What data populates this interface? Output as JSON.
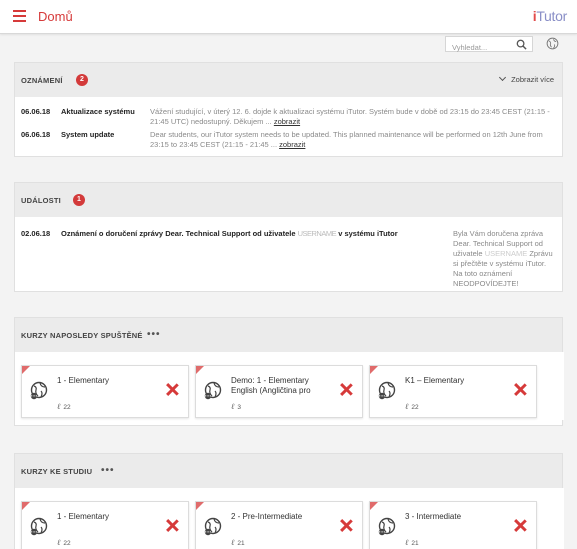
{
  "header": {
    "menu_icon": "hamburger-icon",
    "title": "Domů",
    "logo_part1": "i",
    "logo_part2": "Tutor"
  },
  "search": {
    "placeholder": "Vyhledat...",
    "search_icon": "search-icon",
    "language_icon": "globe-icon"
  },
  "announcements": {
    "title": "OZNÁMENÍ",
    "badge": "2",
    "show_more": "Zobrazit více",
    "items": [
      {
        "date": "06.06.18",
        "title": "Aktualizace systému",
        "text": "Vážení studující, v úterý 12. 6. dojde k aktualizaci systému iTutor. Systém bude v době od 23:15 do 23:45 CEST (21:15 - 21:45 UTC) nedostupný. Děkujem ...",
        "link": "zobrazit"
      },
      {
        "date": "06.06.18",
        "title": "System update",
        "text": "Dear students, our iTutor system needs to be updated. This planned maintenance will be performed on 12th June from 23:15 to 23:45 CEST (21:15 - 21:45 ...",
        "link": "zobrazit"
      }
    ]
  },
  "events": {
    "title": "UDÁLOSTI",
    "badge": "1",
    "items": [
      {
        "date": "02.06.18",
        "title_prefix": "Oznámení o doručení zprávy Dear. Technical Support od uživatele",
        "title_blurred": "USERNAME",
        "title_suffix": "v systému iTutor",
        "text_prefix": "Byla Vám doručena zpráva Dear. Technical Support od uživatele",
        "text_blurred": "USERNAME",
        "text_suffix": "Zprávu si přečtěte v systému iTutor. Na toto oznámení NEODPOVÍDEJTE!"
      }
    ]
  },
  "recent_courses": {
    "title": "KURZY NAPOSLEDY SPUŠTĚNÉ",
    "more": "•••",
    "cards": [
      {
        "title": "1 - Elementary",
        "count": "22"
      },
      {
        "title": "Demo: 1 - Elementary English (Angličtina pro",
        "count": "3"
      },
      {
        "title": "K1 – Elementary",
        "count": "22"
      }
    ]
  },
  "study_courses": {
    "title": "KURZY KE STUDIU",
    "more": "•••",
    "cards": [
      {
        "title": "1 - Elementary",
        "count": "22"
      },
      {
        "title": "2 - Pre-Intermediate",
        "count": "21"
      },
      {
        "title": "3 - Intermediate",
        "count": "21"
      }
    ]
  },
  "colors": {
    "accent": "#d63a3a",
    "header_bg": "#ebebeb"
  }
}
